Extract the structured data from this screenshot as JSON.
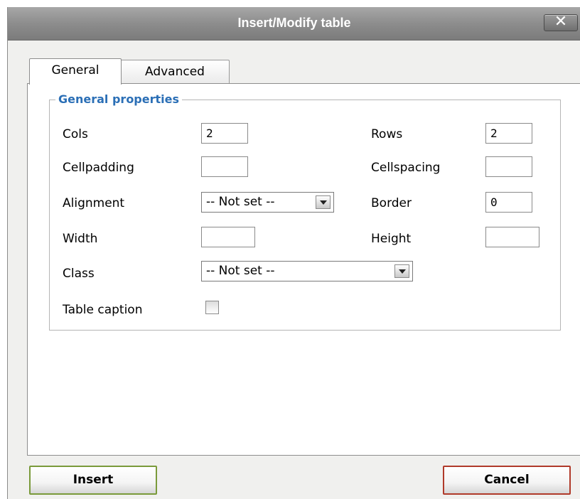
{
  "dialog": {
    "title": "Insert/Modify table",
    "close_label": "✕"
  },
  "tabs": [
    {
      "label": "General",
      "active": true
    },
    {
      "label": "Advanced",
      "active": false
    }
  ],
  "fieldset": {
    "legend": "General properties"
  },
  "fields": {
    "cols": {
      "label": "Cols",
      "value": "2"
    },
    "rows": {
      "label": "Rows",
      "value": "2"
    },
    "cellpadding": {
      "label": "Cellpadding",
      "value": ""
    },
    "cellspacing": {
      "label": "Cellspacing",
      "value": ""
    },
    "alignment": {
      "label": "Alignment",
      "value": "-- Not set --"
    },
    "border": {
      "label": "Border",
      "value": "0"
    },
    "width": {
      "label": "Width",
      "value": ""
    },
    "height": {
      "label": "Height",
      "value": ""
    },
    "class": {
      "label": "Class",
      "value": "-- Not set --"
    },
    "caption": {
      "label": "Table caption",
      "checked": false
    }
  },
  "buttons": {
    "insert": "Insert",
    "cancel": "Cancel"
  },
  "colors": {
    "legend": "#2b6fb6",
    "insert_border": "#7a9a3a",
    "cancel_border": "#b03a2a"
  }
}
